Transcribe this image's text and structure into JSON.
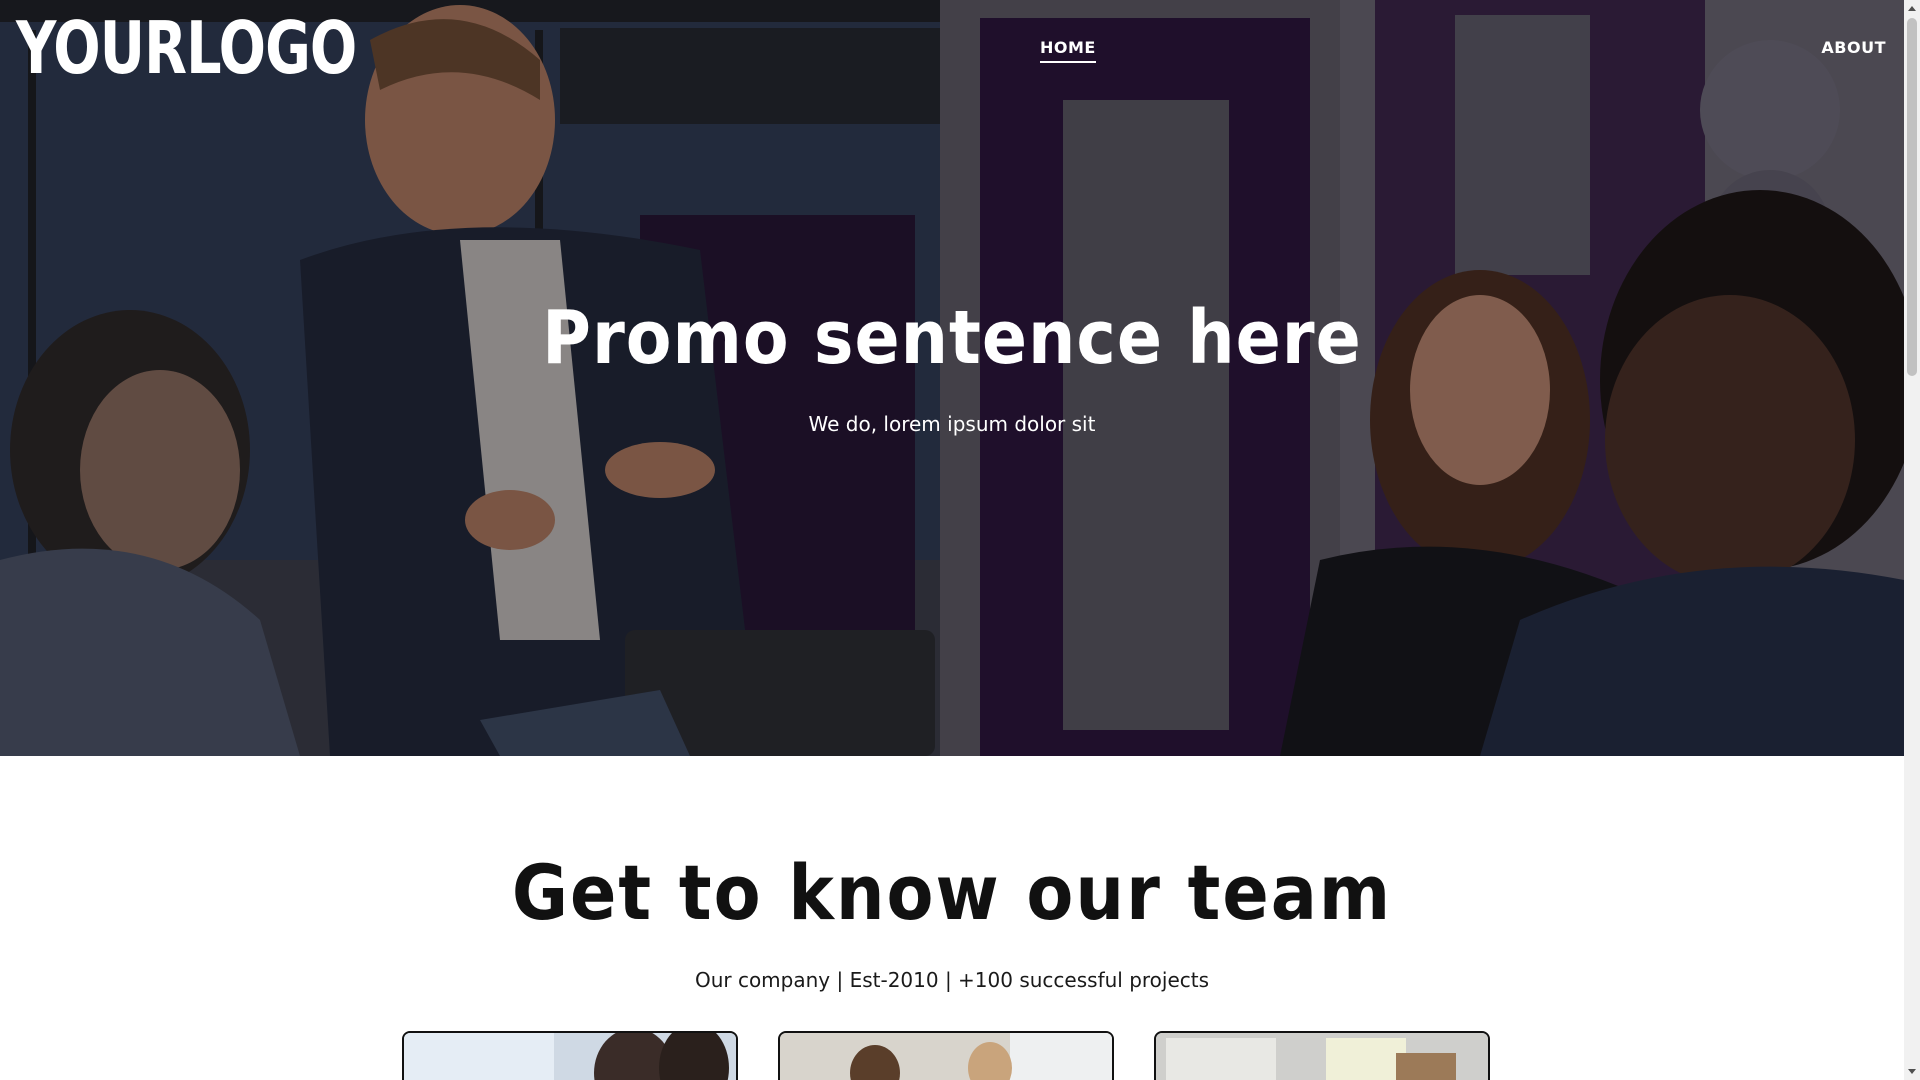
{
  "header": {
    "logo": "YOURLOGO",
    "nav": [
      {
        "label": "HOME",
        "active": true
      },
      {
        "label": "ABOUT",
        "active": false
      }
    ]
  },
  "hero": {
    "title": "Promo sentence here",
    "subtitle": "We do, lorem ipsum dolor sit"
  },
  "team": {
    "title": "Get to know our team",
    "subtitle": "Our company | Est-2010 | +100 successful projects",
    "cards": 3
  },
  "colors": {
    "text_light": "#ffffff",
    "text_dark": "#111111",
    "accent_purple": "#2a1338",
    "card_border": "#111111"
  }
}
